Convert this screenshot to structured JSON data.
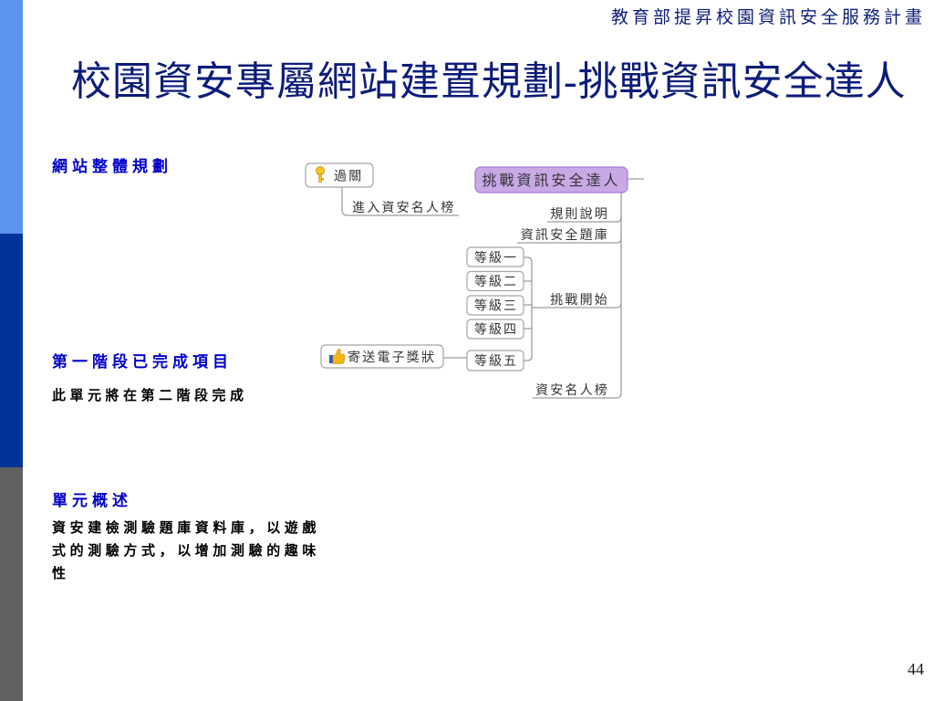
{
  "header": {
    "program_title": "教育部提昇校園資訊安全服務計畫"
  },
  "slide": {
    "title": "校園資安專屬網站建置規劃-挑戰資訊安全達人",
    "page_number": "44"
  },
  "left_panel": {
    "sections": [
      {
        "heading": "網站整體規劃"
      },
      {
        "heading": "第一階段已完成項目",
        "body": "此單元將在第二階段完成"
      },
      {
        "heading": "單元概述",
        "body": "資安建檢測驗題庫資料庫，以遊戲式的測驗方式，以增加測驗的趣味性"
      }
    ]
  },
  "mind_map": {
    "root": {
      "label": "挑戰資訊安全達人"
    },
    "branches": [
      {
        "label": "規則說明"
      },
      {
        "label": "資訊安全題庫"
      },
      {
        "label": "挑戰開始",
        "children": [
          {
            "label": "等級一"
          },
          {
            "label": "等級二"
          },
          {
            "label": "等級三"
          },
          {
            "label": "等級四"
          },
          {
            "label": "等級五",
            "children": [
              {
                "label": "寄送電子獎狀",
                "icon": "thumbs-up-icon"
              }
            ]
          }
        ]
      },
      {
        "label": "資安名人榜"
      }
    ],
    "floating_topic": {
      "label": "過關",
      "icon": "key-icon",
      "children": [
        {
          "label": "進入資安名人榜"
        }
      ]
    }
  },
  "theme": {
    "sidebar_top": "#5b93ef",
    "sidebar_middle": "#003399",
    "sidebar_bottom": "#606060",
    "header_text": "#0c1c7a",
    "title": "#0c1c7a",
    "section_heading": "#0000cc",
    "body_text": "#000000",
    "page_number": "#1a1a1a",
    "root_fill": "#c9a8e6",
    "root_border": "#a57dcf",
    "node_border": "#a5a5a5",
    "connector": "#9e9e9e",
    "node_text": "#333333"
  }
}
